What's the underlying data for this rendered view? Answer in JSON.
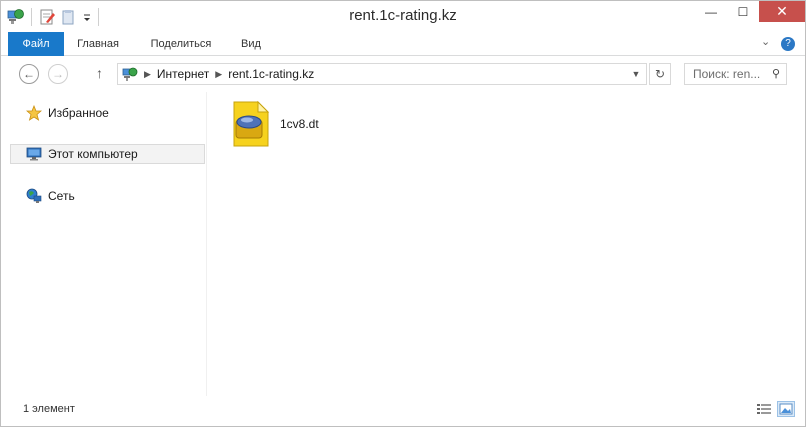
{
  "window": {
    "title": "rent.1c-rating.kz"
  },
  "quick_access": {
    "icons": [
      "network-location-icon",
      "properties-icon",
      "new-folder-icon",
      "customize-dropdown-icon"
    ]
  },
  "window_controls": {
    "minimize": "—",
    "maximize": "☐",
    "close": "✕"
  },
  "ribbon": {
    "tabs": [
      {
        "label": "Файл"
      },
      {
        "label": "Главная"
      },
      {
        "label": "Поделиться"
      },
      {
        "label": "Вид"
      }
    ],
    "expand_glyph": "⌄",
    "help_glyph": "?"
  },
  "address_bar": {
    "back_glyph": "←",
    "forward_glyph": "→",
    "up_glyph": "↑",
    "breadcrumbs": [
      "Интернет",
      "rent.1c-rating.kz"
    ],
    "chevron": "▶",
    "dropdown_glyph": "▼",
    "refresh_glyph": "↻"
  },
  "search": {
    "placeholder": "Поиск: ren...",
    "icon_glyph": "⚲"
  },
  "nav_pane": {
    "items": [
      {
        "label": "Избранное",
        "icon": "favorites-star-icon"
      },
      {
        "label": "Этот компьютер",
        "icon": "computer-icon"
      },
      {
        "label": "Сеть",
        "icon": "network-icon"
      }
    ]
  },
  "content": {
    "files": [
      {
        "name": "1cv8.dt",
        "icon": "1c-database-file-icon"
      }
    ]
  },
  "status_bar": {
    "item_count": "1 элемент"
  },
  "colors": {
    "file_tab": "#1979ca",
    "close_button": "#c7504c",
    "selection_bg": "#f3f3f3"
  }
}
